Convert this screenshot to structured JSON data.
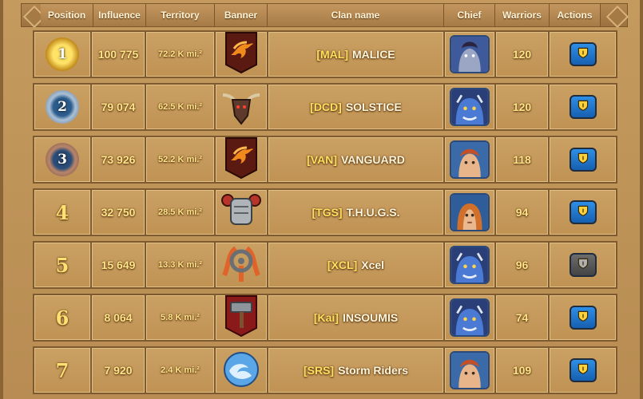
{
  "columns": {
    "position": "Position",
    "influence": "Influence",
    "territory": "Territory",
    "banner": "Banner",
    "clan_name": "Clan name",
    "chief": "Chief",
    "warriors": "Warriors",
    "actions": "Actions"
  },
  "rows": [
    {
      "position": "1",
      "influence": "100 775",
      "territory": "72.2 K mi.²",
      "banner_icon": "orange-dragon-banner-icon",
      "tag": "[MAL]",
      "name": "MALICE",
      "chief_icon": "vampire-chief-avatar",
      "warriors": "120",
      "action_state": "active"
    },
    {
      "position": "2",
      "influence": "79 074",
      "territory": "62.5 K mi.²",
      "banner_icon": "horned-beast-banner-icon",
      "tag": "[DCD]",
      "name": "SOLSTICE",
      "chief_icon": "blue-ogre-chief-avatar",
      "warriors": "120",
      "action_state": "active"
    },
    {
      "position": "3",
      "influence": "73 926",
      "territory": "52.2 K mi.²",
      "banner_icon": "orange-dragon-banner-icon",
      "tag": "[VAN]",
      "name": "VANGUARD",
      "chief_icon": "red-haired-warrior-chief-avatar",
      "warriors": "118",
      "action_state": "active"
    },
    {
      "position": "4",
      "influence": "32 750",
      "territory": "28.5 K mi.²",
      "banner_icon": "armored-fist-banner-icon",
      "tag": "[TGS]",
      "name": "T.H.U.G.S.",
      "chief_icon": "long-haired-warrior-chief-avatar",
      "warriors": "94",
      "action_state": "active"
    },
    {
      "position": "5",
      "influence": "15 649",
      "territory": "13.3 K mi.²",
      "banner_icon": "triskele-banner-icon",
      "tag": "[XCL]",
      "name": "Xcel",
      "chief_icon": "blue-ogre-chief-avatar",
      "warriors": "96",
      "action_state": "disabled"
    },
    {
      "position": "6",
      "influence": "8 064",
      "territory": "5.8 K mi.²",
      "banner_icon": "hammer-banner-icon",
      "tag": "[Kai]",
      "name": "INSOUMIS",
      "chief_icon": "blue-ogre-chief-avatar",
      "warriors": "74",
      "action_state": "active"
    },
    {
      "position": "7",
      "influence": "7 920",
      "territory": "2.4 K mi.²",
      "banner_icon": "water-swirl-banner-icon",
      "tag": "[SRS]",
      "name": "Storm Riders",
      "chief_icon": "red-haired-warrior-chief-avatar",
      "warriors": "109",
      "action_state": "active"
    }
  ],
  "colors": {
    "panel_bg": "#c09354",
    "value_text": "#ffe489",
    "action_blue": "#1e7bd6",
    "action_grey": "#555555"
  }
}
